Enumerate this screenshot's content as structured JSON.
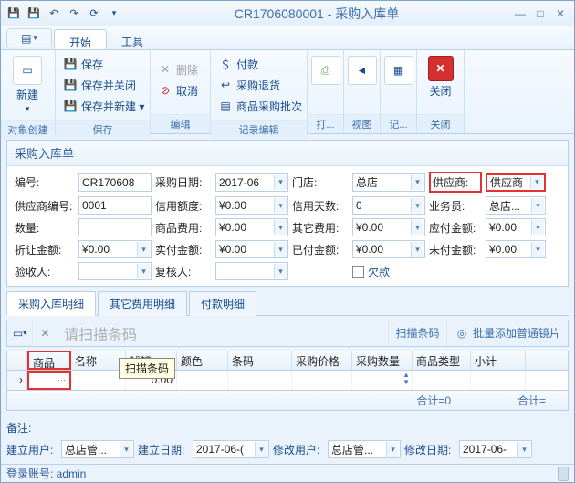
{
  "window": {
    "title": "CR1706080001 - 采购入库单"
  },
  "qa": [
    "floppy-icon",
    "floppy-x-icon",
    "undo-icon",
    "redo-icon",
    "refresh-icon"
  ],
  "tabs": {
    "dropdown": "▾",
    "items": [
      "开始",
      "工具"
    ],
    "active": 0
  },
  "ribbon": {
    "groups": [
      {
        "label": "对象创建",
        "big": {
          "label": "新建",
          "dd": true
        }
      },
      {
        "label": "保存",
        "small": [
          "保存",
          "保存并关闭",
          "保存并新建 ▾"
        ]
      },
      {
        "label": "编辑",
        "big_small": [
          {
            "ico": "✕",
            "label": "删除",
            "disabled": true
          },
          {
            "ico": "⊘",
            "label": "取消",
            "disabled": false
          }
        ]
      },
      {
        "label": "记录编辑",
        "small": [
          "付款",
          "采购退货",
          "商品采购批次"
        ]
      },
      {
        "label": "打...",
        "big_icon": "print"
      },
      {
        "label": "视图",
        "big_icon": "back"
      },
      {
        "label": "记...",
        "big_icon": "list"
      },
      {
        "label": "关闭",
        "big": {
          "label": "关闭",
          "close": true
        }
      }
    ]
  },
  "form": {
    "title": "采购入库单",
    "rows": [
      [
        {
          "l": "编号:",
          "v": "CR170608"
        },
        {
          "l": "采购日期:",
          "v": "2017-06",
          "dd": true
        },
        {
          "l": "门店:",
          "v": "总店",
          "dd": true
        },
        {
          "l": "供应商:",
          "v": "供应商",
          "dd": true,
          "hl": true
        }
      ],
      [
        {
          "l": "供应商编号:",
          "v": "0001"
        },
        {
          "l": "信用额度:",
          "v": "¥0.00",
          "dd": true
        },
        {
          "l": "信用天数:",
          "v": "0",
          "dd": true
        },
        {
          "l": "业务员:",
          "v": "总店...",
          "dd": true
        }
      ],
      [
        {
          "l": "数量:",
          "v": ""
        },
        {
          "l": "商品费用:",
          "v": "¥0.00",
          "dd": true
        },
        {
          "l": "其它费用:",
          "v": "¥0.00",
          "dd": true
        },
        {
          "l": "应付金额:",
          "v": "¥0.00",
          "dd": true
        }
      ],
      [
        {
          "l": "折让金额:",
          "v": "¥0.00",
          "dd": true
        },
        {
          "l": "实付金额:",
          "v": "¥0.00",
          "dd": true
        },
        {
          "l": "已付金额:",
          "v": "¥0.00",
          "dd": true
        },
        {
          "l": "未付金额:",
          "v": "¥0.00",
          "dd": true
        }
      ],
      [
        {
          "l": "验收人:",
          "v": "",
          "dd": true
        },
        {
          "l": "复核人:",
          "v": "",
          "dd": true
        },
        {
          "l": "",
          "chk": true,
          "chklabel": "欠款"
        },
        {}
      ]
    ]
  },
  "sub_tabs": [
    "采购入库明细",
    "其它费用明细",
    "付款明细"
  ],
  "scanbar": {
    "placeholder": "请扫描条码",
    "label": "扫描条码",
    "batch": "批量添加普通镜片",
    "tooltip": "扫描条码"
  },
  "grid": {
    "headers": [
      "",
      "商品",
      "名称",
      "球镜",
      "颜色",
      "条码",
      "采购价格",
      "采购数量",
      "商品类型",
      "小计"
    ],
    "row": {
      "球镜": "0.00",
      "采购数量_spin": true
    },
    "sum_left": "合计=0",
    "sum_right": "合计="
  },
  "remark_label": "备注:",
  "footer": [
    {
      "l": "建立用户:",
      "v": "总店管...",
      "dd": true
    },
    {
      "l": "建立日期:",
      "v": "2017-06-(",
      "dd": true
    },
    {
      "l": "修改用户:",
      "v": "总店管...",
      "dd": true
    },
    {
      "l": "修改日期:",
      "v": "2017-06-",
      "dd": true
    }
  ],
  "status": "登录账号: admin"
}
